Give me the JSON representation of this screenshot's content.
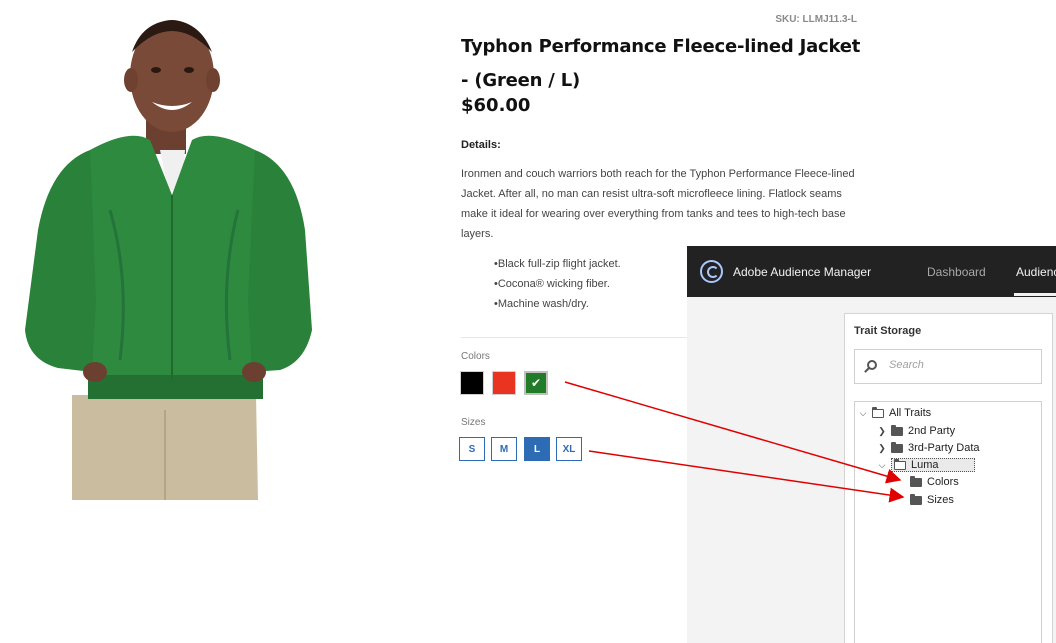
{
  "product": {
    "sku": "SKU: LLMJ11.3-L",
    "title": "Typhon Performance Fleece-lined Jacket - (Green / L)",
    "price": "$60.00",
    "details_heading": "Details:",
    "description": "Ironmen and couch warriors both reach for the Typhon Performance Fleece-lined Jacket. After all, no man can resist ultra-soft microfleece lining. Flatlock seams make it ideal for wearing over everything from tanks and tees to high-tech base layers.",
    "features": [
      "Black full-zip flight jacket.",
      "Cocona® wicking fiber.",
      "Machine wash/dry."
    ],
    "colors_label": "Colors",
    "colors": [
      {
        "name": "black",
        "hex": "#000000"
      },
      {
        "name": "red",
        "hex": "#e93421"
      },
      {
        "name": "green",
        "hex": "#217b29",
        "selected": true,
        "check": "✔"
      }
    ],
    "sizes_label": "Sizes",
    "sizes": [
      {
        "label": "S"
      },
      {
        "label": "M"
      },
      {
        "label": "L",
        "selected": true
      },
      {
        "label": "XL"
      }
    ]
  },
  "aam": {
    "app_name": "Adobe Audience Manager",
    "nav": {
      "dashboard": "Dashboard",
      "audience": "Audience"
    },
    "trait_storage": {
      "title": "Trait Storage",
      "search_placeholder": "Search",
      "tree": {
        "all_traits": "All Traits",
        "second_party": "2nd Party",
        "third_party": "3rd-Party Data",
        "luma": "Luma",
        "colors": "Colors",
        "sizes": "Sizes"
      }
    }
  },
  "theme": {
    "accent": "#2e6bb5",
    "arrow": "#e00000",
    "header_bg": "#222222"
  }
}
